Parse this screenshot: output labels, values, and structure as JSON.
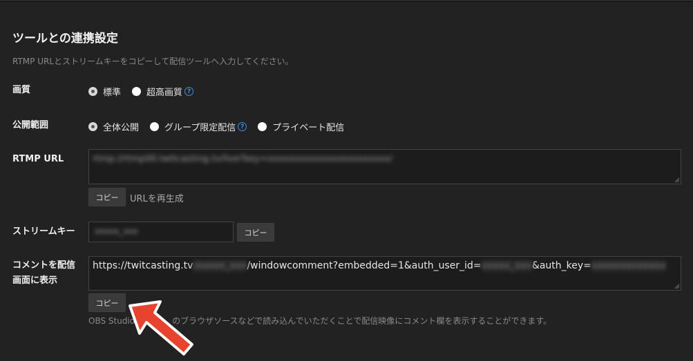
{
  "section": {
    "title": "ツールとの連携設定",
    "description": "RTMP URLとストリームキーをコピーして配信ツールへ入力してください。"
  },
  "quality": {
    "label": "画質",
    "options": [
      "標準",
      "超高画質"
    ],
    "selected": "標準"
  },
  "visibility": {
    "label": "公開範囲",
    "options": [
      "全体公開",
      "グループ限定配信",
      "プライベート配信"
    ],
    "selected": "全体公開"
  },
  "rtmp": {
    "label": "RTMP URL",
    "value": "rtmp://rtmp00.twitcasting.tv/live?key=xxxxxxxxxxxxxxxxxxxxxxx/",
    "copy_label": "コピー",
    "regen_label": "URLを再生成"
  },
  "stream_key": {
    "label": "ストリームキー",
    "value": "xxxxx_xxx",
    "copy_label": "コピー"
  },
  "comment_embed": {
    "label_line1": "コメントを配信",
    "label_line2": "画面に表示",
    "url_prefix": "https://twitcasting.tv",
    "url_hidden1": "/xxxxx_xxx",
    "url_mid": "/windowcomment?embedded=1&auth_user_id=",
    "url_hidden2": "xxxxx_xxx",
    "url_mid2": "&auth_key=",
    "url_hidden3": "xxxxxxxxxxxxx",
    "copy_label": "コピー",
    "note_prefix": "OBS Studio",
    "note_suffix": "のブラウザソースなどで読み込んでいただくことで配信映像にコメント欄を表示することができます。"
  },
  "colors": {
    "background": "#222222",
    "help_icon": "#3f8fe0",
    "arrow": "#e8432e"
  },
  "icons": {
    "help": "question-circle-icon",
    "arrow": "red-arrow-pointer-icon"
  }
}
